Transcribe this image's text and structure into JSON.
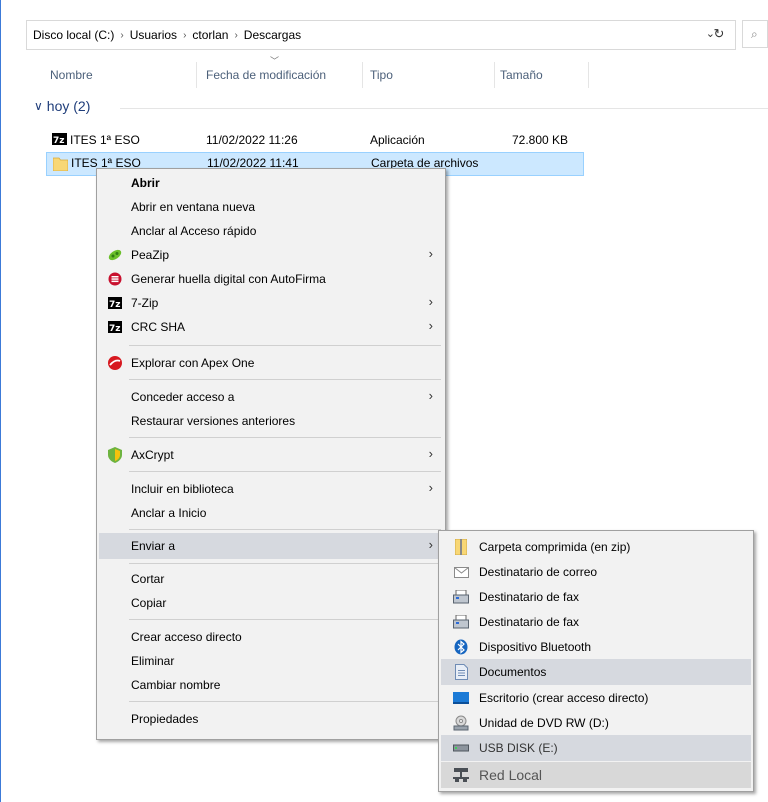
{
  "address": {
    "crumbs": [
      "Disco local (C:)",
      "Usuarios",
      "ctorlan",
      "Descargas"
    ],
    "separator": "›",
    "dropdown_glyph": "⌄",
    "refresh_glyph": "↻",
    "search_glyph": "⌕"
  },
  "columns": [
    "Nombre",
    "Fecha de modificación",
    "Tipo",
    "Tamaño"
  ],
  "group": {
    "label": "hoy (2)",
    "chevron": "∨"
  },
  "files": [
    {
      "name": "ITES 1ª ESO",
      "date": "11/02/2022 11:26",
      "type": "Aplicación",
      "size": "72.800 KB",
      "icon": "7zip-icon"
    },
    {
      "name": "ITES 1ª ESO",
      "date": "11/02/2022 11:41",
      "type": "Carpeta de archivos",
      "size": "",
      "icon": "folder-icon"
    }
  ],
  "context_menu": {
    "items": [
      {
        "label": "Abrir",
        "bold": true
      },
      {
        "label": "Abrir en ventana nueva"
      },
      {
        "label": "Anclar al Acceso rápido"
      },
      {
        "label": "PeaZip",
        "icon": "peazip-icon",
        "submenu": true
      },
      {
        "label": "Generar huella digital con AutoFirma",
        "icon": "autofirma-icon"
      },
      {
        "label": "7-Zip",
        "icon": "7zip-icon",
        "submenu": true
      },
      {
        "label": "CRC SHA",
        "icon": "7zip-icon",
        "submenu": true
      },
      {
        "label": "Explorar con Apex One",
        "icon": "apex-one-icon"
      },
      {
        "label": "Conceder acceso a",
        "submenu": true
      },
      {
        "label": "Restaurar versiones anteriores"
      },
      {
        "label": "AxCrypt",
        "icon": "axcrypt-icon",
        "submenu": true
      },
      {
        "label": "Incluir en biblioteca",
        "submenu": true
      },
      {
        "label": "Anclar a Inicio"
      },
      {
        "label": "Enviar a",
        "submenu": true,
        "highlighted": true
      },
      {
        "label": "Cortar"
      },
      {
        "label": "Copiar"
      },
      {
        "label": "Crear acceso directo"
      },
      {
        "label": "Eliminar"
      },
      {
        "label": "Cambiar nombre"
      },
      {
        "label": "Propiedades"
      }
    ],
    "arrow_glyph": "›"
  },
  "send_to_menu": {
    "items": [
      {
        "label": "Carpeta comprimida (en zip)",
        "icon": "zip-folder-icon"
      },
      {
        "label": "Destinatario de correo",
        "icon": "mail-icon"
      },
      {
        "label": "Destinatario de fax",
        "icon": "fax-icon"
      },
      {
        "label": "Destinatario de fax",
        "icon": "fax-icon"
      },
      {
        "label": "Dispositivo Bluetooth",
        "icon": "bluetooth-icon"
      },
      {
        "label": "Documentos",
        "icon": "documents-icon",
        "highlighted": true
      },
      {
        "label": "Escritorio (crear acceso directo)",
        "icon": "desktop-icon"
      },
      {
        "label": "Unidad de DVD RW (D:)",
        "icon": "dvd-drive-icon"
      },
      {
        "label": "USB DISK (E:)",
        "icon": "usb-drive-icon",
        "highlighted": true
      },
      {
        "label": "Red Local",
        "icon": "network-icon",
        "highlighted": true
      }
    ]
  },
  "colors": {
    "selection": "#cce8ff",
    "menu_bg": "#f2f2f2",
    "menu_highlight": "#d6d9df",
    "header_text": "#4c607a"
  }
}
